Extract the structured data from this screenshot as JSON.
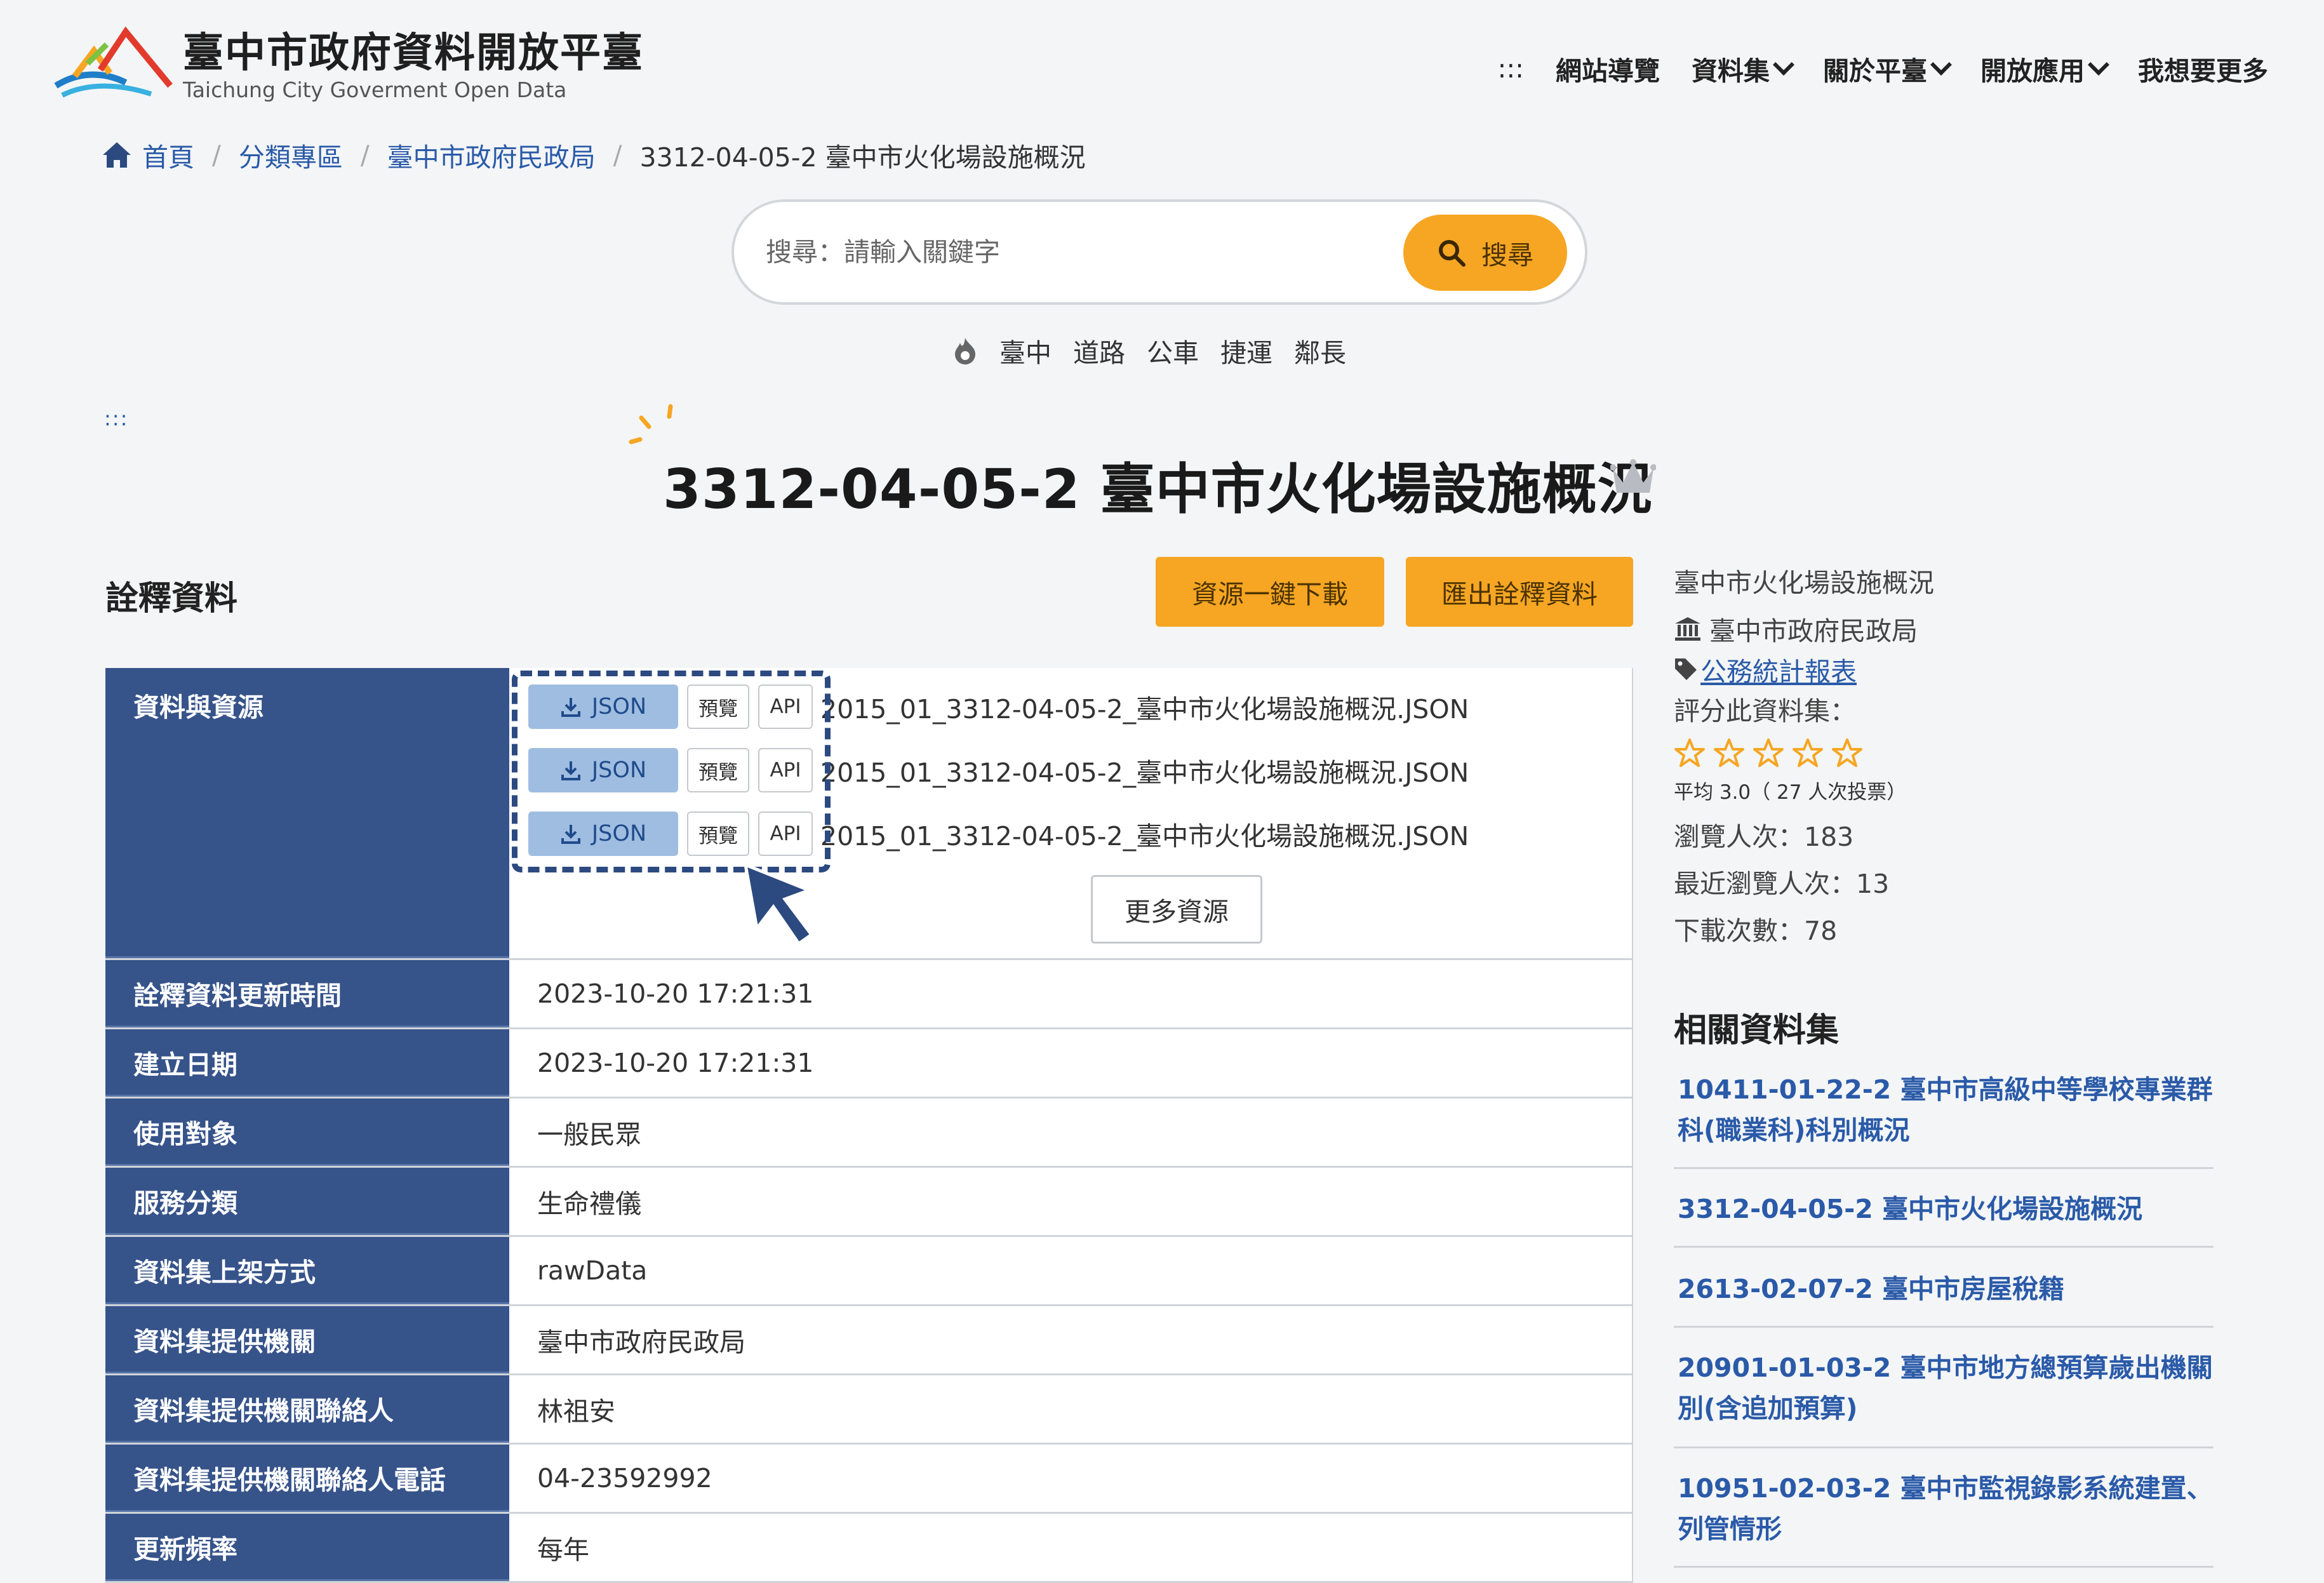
{
  "header": {
    "title": "臺中市政府資料開放平臺",
    "subtitle": "Taichung City Goverment Open Data",
    "nav": [
      {
        "label": ":::"
      },
      {
        "label": "網站導覽"
      },
      {
        "label": "資料集"
      },
      {
        "label": "關於平臺"
      },
      {
        "label": "開放應用"
      },
      {
        "label": "我想要更多"
      }
    ]
  },
  "breadcrumb": {
    "home": "首頁",
    "category": "分類專區",
    "agency": "臺中市政府民政局",
    "current": "3312-04-05-2 臺中市火化場設施概況"
  },
  "search": {
    "placeholder": "搜尋：請輸入關鍵字",
    "button": "搜尋",
    "hot_tags": [
      "臺中",
      "道路",
      "公車",
      "捷運",
      "鄰長"
    ]
  },
  "skip_marker": ":::",
  "page": {
    "title": "3312-04-05-2 臺中市火化場設施概況"
  },
  "metadata": {
    "section_title": "詮釋資料",
    "download_all": "資源一鍵下載",
    "export_meta": "匯出詮釋資料",
    "resources_label": "資料與資源",
    "resources": [
      {
        "format": "JSON",
        "preview": "預覽",
        "api": "API",
        "name": "2015_01_3312-04-05-2_臺中市火化場設施概況.JSON"
      },
      {
        "format": "JSON",
        "preview": "預覽",
        "api": "API",
        "name": "2015_01_3312-04-05-2_臺中市火化場設施概況.JSON"
      },
      {
        "format": "JSON",
        "preview": "預覽",
        "api": "API",
        "name": "2015_01_3312-04-05-2_臺中市火化場設施概況.JSON"
      }
    ],
    "more_resources": "更多資源",
    "rows": [
      {
        "key": "詮釋資料更新時間",
        "value": "2023-10-20 17:21:31"
      },
      {
        "key": "建立日期",
        "value": "2023-10-20 17:21:31"
      },
      {
        "key": "使用對象",
        "value": "一般民眾"
      },
      {
        "key": "服務分類",
        "value": "生命禮儀"
      },
      {
        "key": "資料集上架方式",
        "value": "rawData"
      },
      {
        "key": "資料集提供機關",
        "value": "臺中市政府民政局"
      },
      {
        "key": "資料集提供機關聯絡人",
        "value": "林祖安"
      },
      {
        "key": "資料集提供機關聯絡人電話",
        "value": "04-23592992"
      },
      {
        "key": "更新頻率",
        "value": "每年"
      }
    ]
  },
  "sidebar": {
    "dataset_name": "臺中市火化場設施概況",
    "agency": "臺中市政府民政局",
    "tag": "公務統計報表",
    "rate_label": "評分此資料集：",
    "rating": 0,
    "rating_summary": "平均 3.0（ 27 人次投票）",
    "views": "瀏覽人次：183",
    "recent_views": "最近瀏覽人次：13",
    "downloads": "下載次數：78",
    "related_title": "相關資料集",
    "related": [
      "10411-01-22-2 臺中市高級中等學校專業群科(職業科)科別概況",
      "3312-04-05-2 臺中市火化場設施概況",
      "2613-02-07-2 臺中市房屋稅籍",
      "20901-01-03-2 臺中市地方總預算歲出機關別(含追加預算)",
      "10951-02-03-2 臺中市監視錄影系統建置、列管情形"
    ]
  },
  "colors": {
    "accent_orange": "#f6a623",
    "navy": "#36538a",
    "link_blue": "#2a5aa8"
  }
}
